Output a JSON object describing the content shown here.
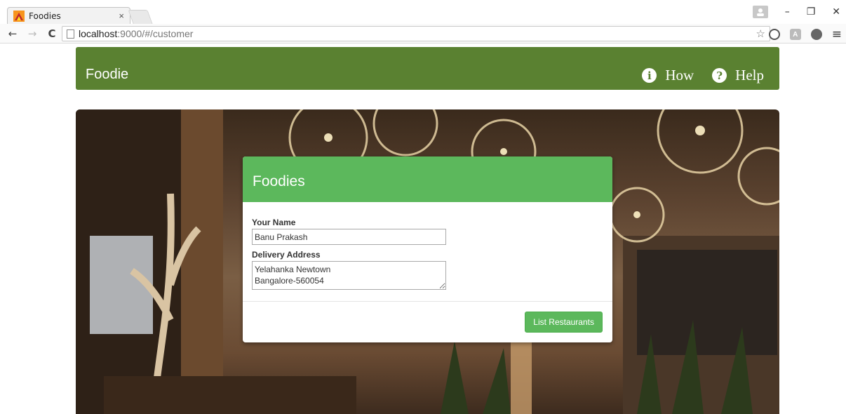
{
  "browser": {
    "tab_title": "Foodies",
    "tab_close": "×",
    "url_host": "localhost",
    "url_rest": ":9000/#/customer",
    "back": "←",
    "forward": "→",
    "reload": "C",
    "star": "☆",
    "minimize": "–",
    "restore": "❐",
    "close": "✕",
    "menu": "≡",
    "ext_a": "A"
  },
  "navbar": {
    "brand": "Foodie",
    "links": [
      {
        "icon": "i",
        "label": "How"
      },
      {
        "icon": "?",
        "label": "Help"
      }
    ]
  },
  "form": {
    "title": "Foodies",
    "name_label": "Your Name",
    "name_value": "Banu Prakash",
    "address_label": "Delivery Address",
    "address_value": "Yelahanka Newtown\nBangalore-560054",
    "submit_label": "List Restaurants"
  },
  "colors": {
    "navbar": "#5a8131",
    "card_header": "#5cb85c",
    "button": "#5cb85c"
  }
}
